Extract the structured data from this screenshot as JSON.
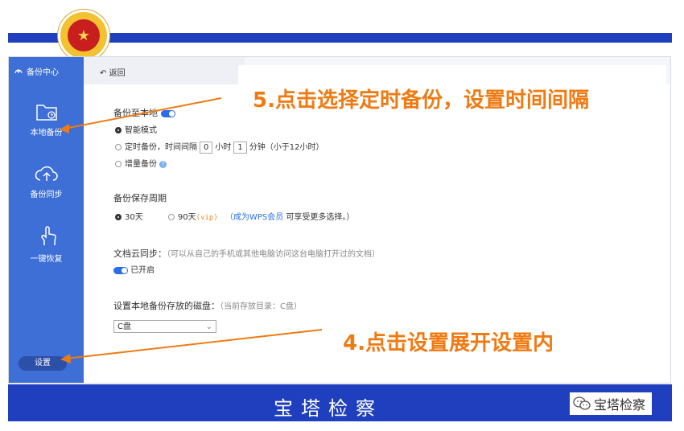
{
  "header": {
    "emblem_glyph": "★",
    "colors": {
      "bar": "#1f3fbf",
      "emblem": "#f2c230"
    }
  },
  "sidebar": {
    "title": "备份中心",
    "items": [
      {
        "label": "本地备份",
        "icon": "folder-clock-icon"
      },
      {
        "label": "备份同步",
        "icon": "cloud-upload-icon"
      },
      {
        "label": "一键恢复",
        "icon": "hand-pointer-icon"
      }
    ],
    "settings_label": "设置"
  },
  "toolbar": {
    "back_label": "返回"
  },
  "settings": {
    "backup_local_label": "备份至本地",
    "mode_smart": "智能模式",
    "mode_timed_prefix": "定时备份，时间间隔",
    "hours_value": "0",
    "hours_unit": "小时",
    "minutes_value": "1",
    "minutes_unit": "分钟（小于12小时）",
    "mode_incremental": "增量备份",
    "retention_label": "备份保存周期",
    "retention_30": "30天",
    "retention_90": "90天",
    "retention_vip": "(vip)",
    "vip_link_open": "（",
    "vip_link": "成为WPS会员",
    "vip_suffix": "可享受更多选择。）",
    "cloud_sync_label": "文档云同步：",
    "cloud_sync_desc": "（可以从自己的手机或其他电脑访问这台电脑打开过的文档）",
    "cloud_sync_status": "已开启",
    "disk_label": "设置本地备份存放的磁盘：",
    "disk_current": "（当前存放目录：C盘）",
    "disk_value": "C盘"
  },
  "annotations": {
    "step5": "5.点击选择定时备份，设置时间间隔",
    "step4": "4.点击设置展开设置内",
    "color": "#f07a12"
  },
  "footer": {
    "title": "宝塔检察",
    "wechat_label": "宝塔检察"
  }
}
